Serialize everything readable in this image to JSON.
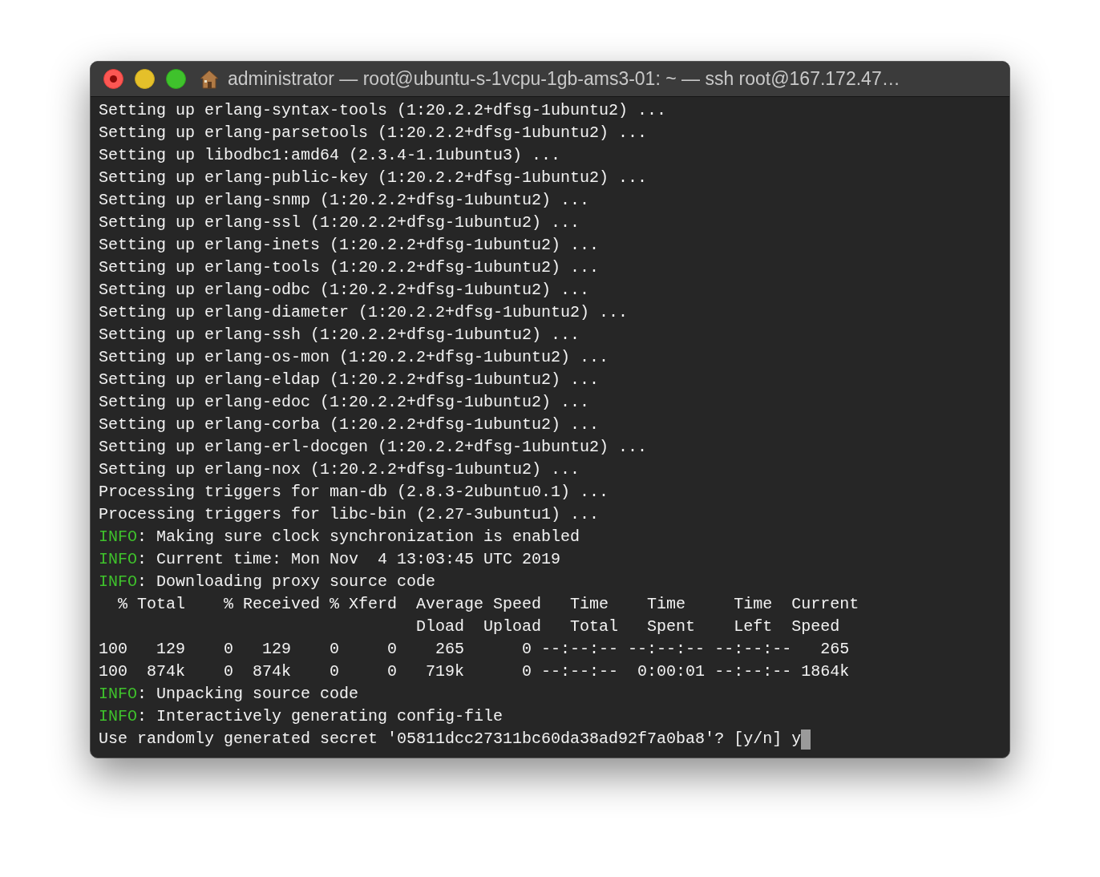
{
  "window": {
    "title": "administrator — root@ubuntu-s-1vcpu-1gb-ams3-01: ~ — ssh root@167.172.47…"
  },
  "lines": [
    {
      "kind": "plain",
      "text": "Setting up erlang-syntax-tools (1:20.2.2+dfsg-1ubuntu2) ..."
    },
    {
      "kind": "plain",
      "text": "Setting up erlang-parsetools (1:20.2.2+dfsg-1ubuntu2) ..."
    },
    {
      "kind": "plain",
      "text": "Setting up libodbc1:amd64 (2.3.4-1.1ubuntu3) ..."
    },
    {
      "kind": "plain",
      "text": "Setting up erlang-public-key (1:20.2.2+dfsg-1ubuntu2) ..."
    },
    {
      "kind": "plain",
      "text": "Setting up erlang-snmp (1:20.2.2+dfsg-1ubuntu2) ..."
    },
    {
      "kind": "plain",
      "text": "Setting up erlang-ssl (1:20.2.2+dfsg-1ubuntu2) ..."
    },
    {
      "kind": "plain",
      "text": "Setting up erlang-inets (1:20.2.2+dfsg-1ubuntu2) ..."
    },
    {
      "kind": "plain",
      "text": "Setting up erlang-tools (1:20.2.2+dfsg-1ubuntu2) ..."
    },
    {
      "kind": "plain",
      "text": "Setting up erlang-odbc (1:20.2.2+dfsg-1ubuntu2) ..."
    },
    {
      "kind": "plain",
      "text": "Setting up erlang-diameter (1:20.2.2+dfsg-1ubuntu2) ..."
    },
    {
      "kind": "plain",
      "text": "Setting up erlang-ssh (1:20.2.2+dfsg-1ubuntu2) ..."
    },
    {
      "kind": "plain",
      "text": "Setting up erlang-os-mon (1:20.2.2+dfsg-1ubuntu2) ..."
    },
    {
      "kind": "plain",
      "text": "Setting up erlang-eldap (1:20.2.2+dfsg-1ubuntu2) ..."
    },
    {
      "kind": "plain",
      "text": "Setting up erlang-edoc (1:20.2.2+dfsg-1ubuntu2) ..."
    },
    {
      "kind": "plain",
      "text": "Setting up erlang-corba (1:20.2.2+dfsg-1ubuntu2) ..."
    },
    {
      "kind": "plain",
      "text": "Setting up erlang-erl-docgen (1:20.2.2+dfsg-1ubuntu2) ..."
    },
    {
      "kind": "plain",
      "text": "Setting up erlang-nox (1:20.2.2+dfsg-1ubuntu2) ..."
    },
    {
      "kind": "plain",
      "text": "Processing triggers for man-db (2.8.3-2ubuntu0.1) ..."
    },
    {
      "kind": "plain",
      "text": "Processing triggers for libc-bin (2.27-3ubuntu1) ..."
    },
    {
      "kind": "info",
      "tag": "INFO",
      "text": ": Making sure clock synchronization is enabled"
    },
    {
      "kind": "info",
      "tag": "INFO",
      "text": ": Current time: Mon Nov  4 13:03:45 UTC 2019"
    },
    {
      "kind": "info",
      "tag": "INFO",
      "text": ": Downloading proxy source code"
    },
    {
      "kind": "plain",
      "text": "  % Total    % Received % Xferd  Average Speed   Time    Time     Time  Current"
    },
    {
      "kind": "plain",
      "text": "                                 Dload  Upload   Total   Spent    Left  Speed"
    },
    {
      "kind": "plain",
      "text": "100   129    0   129    0     0    265      0 --:--:-- --:--:-- --:--:--   265"
    },
    {
      "kind": "plain",
      "text": "100  874k    0  874k    0     0   719k      0 --:--:--  0:00:01 --:--:-- 1864k"
    },
    {
      "kind": "info",
      "tag": "INFO",
      "text": ": Unpacking source code"
    },
    {
      "kind": "info",
      "tag": "INFO",
      "text": ": Interactively generating config-file"
    },
    {
      "kind": "prompt",
      "text": "Use randomly generated secret '05811dcc27311bc60da38ad92f7a0ba8'? [y/n] y",
      "cursor": true
    }
  ]
}
